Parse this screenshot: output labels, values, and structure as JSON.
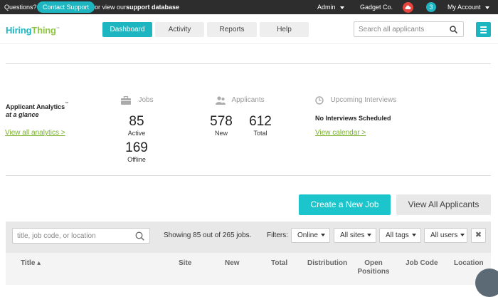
{
  "topbar": {
    "questions": "Questions?",
    "contact_support": "Contact Support",
    "or_view": "or view our",
    "support_db": "support database",
    "admin": "Admin",
    "company": "Gadget Co.",
    "notification_count": "3",
    "my_account": "My Account"
  },
  "header": {
    "logo_part1": "Hiring",
    "logo_part2": "Thing",
    "logo_tm": "™",
    "nav": [
      "Dashboard",
      "Activity",
      "Reports",
      "Help"
    ],
    "active_nav": "Dashboard",
    "search_placeholder": "Search all applicants"
  },
  "analytics": {
    "title": "Applicant Analytics",
    "title_tm": "™",
    "subtitle": "at a glance",
    "view_link": "View all analytics >",
    "jobs": {
      "label": "Jobs",
      "active_value": "85",
      "active_label": "Active",
      "offline_value": "169",
      "offline_label": "Offline"
    },
    "applicants": {
      "label": "Applicants",
      "new_value": "578",
      "new_label": "New",
      "total_value": "612",
      "total_label": "Total"
    },
    "interviews": {
      "label": "Upcoming Interviews",
      "status": "No Interviews Scheduled",
      "link": "View calendar >"
    }
  },
  "actions": {
    "create_job": "Create a New Job",
    "view_all": "View All Applicants"
  },
  "filters": {
    "search_placeholder": "title, job code, or location",
    "showing": "Showing 85 out of 265 jobs.",
    "filters_label": "Filters:",
    "status": "Online",
    "sites": "All sites",
    "tags": "All tags",
    "users": "All users",
    "clear": "✖"
  },
  "table": {
    "title": "Title ▴",
    "site": "Site",
    "new": "New",
    "total": "Total",
    "distribution": "Distribution",
    "open_positions_1": "Open",
    "open_positions_2": "Positions",
    "job_code": "Job Code",
    "location": "Location"
  },
  "colors": {
    "accent": "#1cb5c0",
    "green": "#8dc63f",
    "topbar": "#2d2d2d",
    "alert": "#e8433d"
  }
}
